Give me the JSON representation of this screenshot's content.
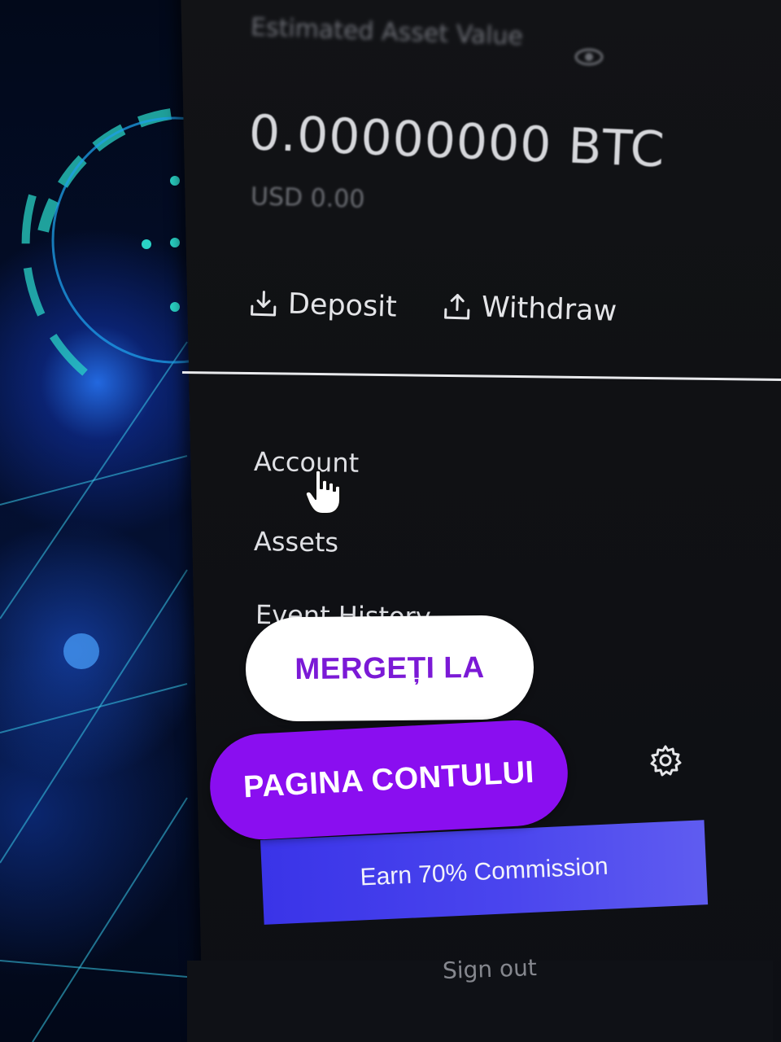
{
  "wallet": {
    "estimated_label": "Estimated Asset Value",
    "balance": "0.00000000 BTC",
    "fiat": "USD 0.00",
    "deposit_label": "Deposit",
    "withdraw_label": "Withdraw"
  },
  "menu": {
    "items": [
      {
        "label": "Account"
      },
      {
        "label": "Assets"
      },
      {
        "label": "Event History"
      }
    ]
  },
  "promo": {
    "earn_label": "Earn 70% Commission"
  },
  "footer": {
    "signout_label": "Sign out"
  },
  "overlay": {
    "line1": "MERGEȚI LA",
    "line2": "PAGINA CONTULUI"
  },
  "icons": {
    "visibility": "eye-icon",
    "deposit": "download-icon",
    "withdraw": "upload-icon",
    "settings": "gear-icon",
    "pointer": "hand-cursor-icon"
  },
  "colors": {
    "panel_bg": "#111216",
    "accent_button": "#4a45ee",
    "overlay_purple": "#8a0ef0",
    "overlay_text_purple": "#7b19d6"
  }
}
